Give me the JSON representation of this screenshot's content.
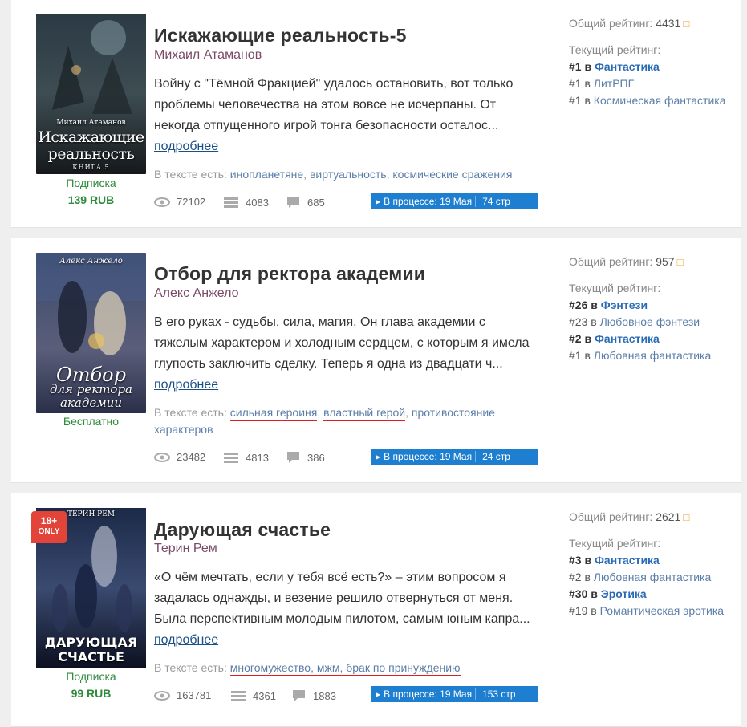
{
  "books": [
    {
      "title": "Искажающие реальность-5",
      "author": "Михаил Атаманов",
      "description": "Войну с \"Тёмной Фракцией\" удалось остановить, вот только проблемы человечества на этом вовсе не исчерпаны. От некогда отпущенного игрой тонга безопасности осталос...",
      "more_label": "подробнее",
      "tags_label": "В тексте есть:",
      "tags": [
        "инопланетяне",
        "виртуальность",
        "космические сражения"
      ],
      "views": "72102",
      "library": "4083",
      "comments": "685",
      "status": "В процессе: 19 Мая",
      "pages": "74 стр",
      "price_type": "Подписка",
      "price": "139 RUB",
      "cover": {
        "author": "Михаил Атаманов",
        "title_line1": "Искажающие",
        "title_line2": "реальность",
        "book": "КНИГА 5"
      },
      "total_rating_label": "Общий рейтинг:",
      "total_rating": "4431",
      "current_rating_label": "Текущий рейтинг:",
      "ranks": [
        {
          "rank": "#1",
          "in": "в",
          "genre": "Фантастика",
          "bold": true
        },
        {
          "rank": "#1",
          "in": "в",
          "genre": "ЛитРПГ",
          "bold": false
        },
        {
          "rank": "#1",
          "in": "в",
          "genre": "Космическая фантастика",
          "bold": false
        }
      ]
    },
    {
      "title": "Отбор для ректора академии",
      "author": "Алекс Анжело",
      "description": "В его руках - судьбы, сила, магия. Он глава академии с тяжелым характером и холодным сердцем, с которым я имела глупость заключить сделку. Теперь я одна из двадцати ч...",
      "more_label": "подробнее",
      "tags_label": "В тексте есть:",
      "tags": [
        "сильная героиня",
        "властный герой",
        "противостояние характеров"
      ],
      "views": "23482",
      "library": "4813",
      "comments": "386",
      "status": "В процессе: 19 Мая",
      "pages": "24 стр",
      "price_type": "Бесплатно",
      "cover": {
        "author": "Алекс Анжело",
        "title_line1": "Отбор",
        "title_line2": "для ректора",
        "title_line3": "академии"
      },
      "total_rating_label": "Общий рейтинг:",
      "total_rating": "957",
      "current_rating_label": "Текущий рейтинг:",
      "ranks": [
        {
          "rank": "#26",
          "in": "в",
          "genre": "Фэнтези",
          "bold": true
        },
        {
          "rank": "#23",
          "in": "в",
          "genre": "Любовное фэнтези",
          "bold": false
        },
        {
          "rank": "#2",
          "in": "в",
          "genre": "Фантастика",
          "bold": true
        },
        {
          "rank": "#1",
          "in": "в",
          "genre": "Любовная фантастика",
          "bold": false
        }
      ]
    },
    {
      "title": "Дарующая счастье",
      "author": "Терин Рем",
      "description": "«О чём мечтать, если у тебя всё есть?» – этим вопросом я задалась однажды, и везение решило отвернуться от меня. Была перспективным молодым пилотом, самым юным капра...",
      "more_label": "подробнее",
      "tags_label": "В тексте есть:",
      "tags": [
        "многомужество",
        "мжм",
        "брак по принуждению"
      ],
      "views": "163781",
      "library": "4361",
      "comments": "1883",
      "status": "В процессе: 19 Мая",
      "pages": "153 стр",
      "price_type": "Подписка",
      "price": "99 RUB",
      "cover": {
        "author": "ТЕРИН РЕМ",
        "title_line1": "ДАРУЮЩАЯ",
        "title_line2": "СЧАСТЬЕ",
        "badge_line1": "18+",
        "badge_line2": "ONLY"
      },
      "total_rating_label": "Общий рейтинг:",
      "total_rating": "2621",
      "current_rating_label": "Текущий рейтинг:",
      "ranks": [
        {
          "rank": "#3",
          "in": "в",
          "genre": "Фантастика",
          "bold": true
        },
        {
          "rank": "#2",
          "in": "в",
          "genre": "Любовная фантастика",
          "bold": false
        },
        {
          "rank": "#30",
          "in": "в",
          "genre": "Эротика",
          "bold": true
        },
        {
          "rank": "#19",
          "in": "в",
          "genre": "Романтическая эротика",
          "bold": false
        }
      ]
    }
  ],
  "icons": {
    "views": "eye-icon",
    "library": "library-icon",
    "comments": "comment-icon",
    "rating_info": "bracket-icon"
  }
}
